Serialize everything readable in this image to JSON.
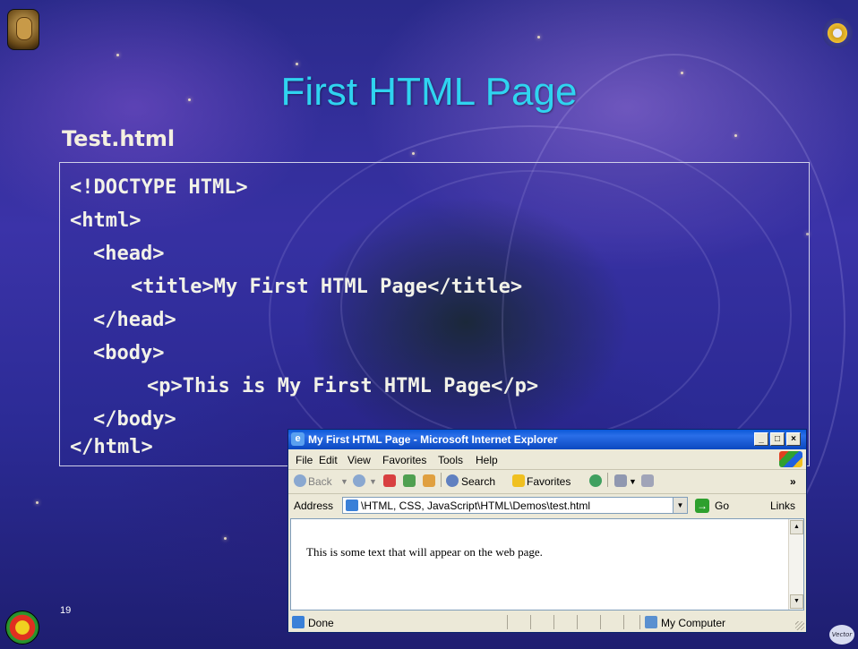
{
  "slide": {
    "title": "First HTML Page",
    "filename": "Test.html",
    "page_number": "19",
    "footer_logo_text": "Vector"
  },
  "code_lines": [
    "<!DOCTYPE HTML>",
    "<html>",
    "<head>",
    "<title>My First HTML Page</title>",
    "</head>",
    "<body>",
    "<p>This is My First HTML Page</p>",
    "</body>",
    "</html>"
  ],
  "ie_window": {
    "title": "My First HTML Page - Microsoft Internet Explorer",
    "menu": [
      "File",
      "Edit",
      "View",
      "Favorites",
      "Tools",
      "Help"
    ],
    "toolbar": {
      "back": "Back",
      "search": "Search",
      "favorites": "Favorites",
      "expand": "»"
    },
    "address_label": "Address",
    "address_value": "\\HTML, CSS, JavaScript\\HTML\\Demos\\test.html",
    "go_label": "Go",
    "links_label": "Links",
    "content_text": "This is some text that will appear on the web page.",
    "status_left": "Done",
    "status_right": "My Computer"
  },
  "colors": {
    "title": "#2fd4f0",
    "code_text": "#f2f2e8",
    "titlebar": "#0a58d8"
  }
}
